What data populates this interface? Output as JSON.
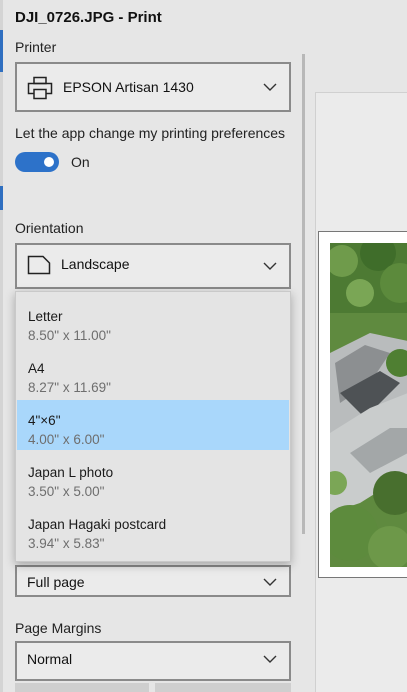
{
  "window": {
    "title": "DJI_0726.JPG - Print"
  },
  "printer": {
    "label": "Printer",
    "selected": "EPSON Artisan 1430",
    "icon": "printer-icon"
  },
  "preferences": {
    "label": "Let the app change my printing preferences",
    "toggle_state": "On",
    "accent_color": "#2d72c9"
  },
  "orientation": {
    "label": "Orientation",
    "selected": "Landscape",
    "icon": "landscape-page-icon"
  },
  "paper_size": {
    "options": [
      {
        "name": "Letter",
        "size": "8.50\" x 11.00\"",
        "selected": false
      },
      {
        "name": "A4",
        "size": "8.27\" x 11.69\"",
        "selected": false
      },
      {
        "name": "4\"×6\"",
        "size": "4.00\" x 6.00\"",
        "selected": true
      },
      {
        "name": "Japan L photo",
        "size": "3.50\" x 5.00\"",
        "selected": false
      },
      {
        "name": "Japan Hagaki postcard",
        "size": "3.94\" x 5.83\"",
        "selected": false
      }
    ],
    "highlight_color": "#a9d7fb"
  },
  "photo_size": {
    "selected": "Full page"
  },
  "page_margins": {
    "label": "Page Margins",
    "selected": "Normal"
  }
}
